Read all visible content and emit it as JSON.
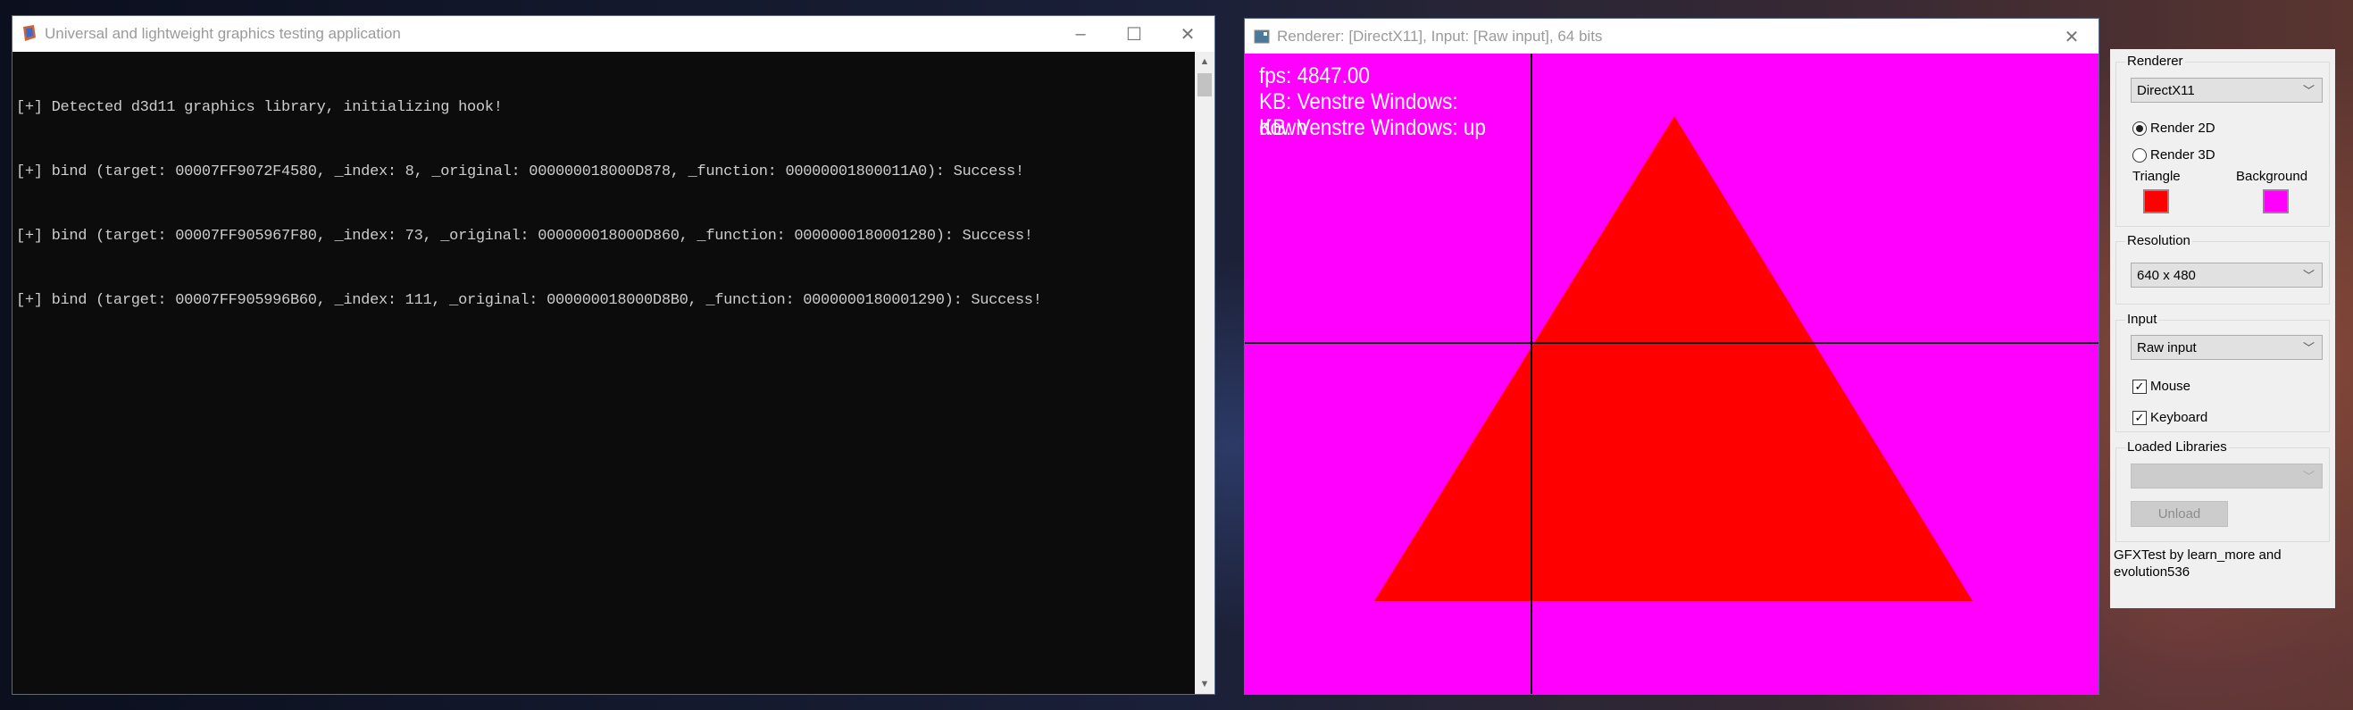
{
  "console": {
    "title": "Universal and lightweight graphics testing application",
    "lines": [
      "[+] Detected d3d11 graphics library, initializing hook!",
      "[+] bind (target: 00007FF9072F4580, _index: 8, _original: 000000018000D878, _function: 00000001800011A0): Success!",
      "[+] bind (target: 00007FF905967F80, _index: 73, _original: 000000018000D860, _function: 0000000180001280): Success!",
      "[+] bind (target: 00007FF905996B60, _index: 111, _original: 000000018000D8B0, _function: 0000000180001290): Success!"
    ]
  },
  "renderer": {
    "title": "Renderer: [DirectX11], Input: [Raw input], 64 bits",
    "hud": [
      "fps: 4847.00",
      "KB: Venstre Windows:",
      "KB: Venstre Windows: up"
    ],
    "hud_overlap": "down",
    "colors": {
      "background": "#ff00ff",
      "triangle": "#ff0000"
    }
  },
  "panel": {
    "renderer_group": "Renderer",
    "renderer_value": "DirectX11",
    "render2d": "Render 2D",
    "render3d": "Render 3D",
    "selected_mode": "Render 2D",
    "triangle_label": "Triangle",
    "background_label": "Background",
    "triangle_color": "#ff0000",
    "background_color": "#ff00ff",
    "resolution_group": "Resolution",
    "resolution_value": "640 x 480",
    "input_group": "Input",
    "input_value": "Raw input",
    "mouse": "Mouse",
    "mouse_checked": true,
    "keyboard": "Keyboard",
    "keyboard_checked": true,
    "libraries_group": "Loaded Libraries",
    "libraries_value": "",
    "unload": "Unload",
    "footer": "GFXTest by learn_more and evolution536"
  }
}
